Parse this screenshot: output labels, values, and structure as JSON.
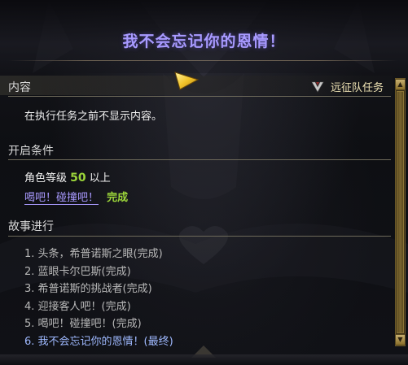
{
  "title": "我不会忘记你的恩情！",
  "content": {
    "header": "内容",
    "quest_type_label": "远征队任务",
    "text": "在执行任务之前不显示内容。"
  },
  "conditions": {
    "header": "开启条件",
    "level_label": "角色等级",
    "level_value": "50",
    "level_suffix": "以上",
    "prereq_quest": "喝吧！碰撞吧！",
    "prereq_status": "完成"
  },
  "story": {
    "header": "故事进行",
    "items": [
      "1. 头条，希普诺斯之眼(完成)",
      "2. 蓝眼卡尔巴斯(完成)",
      "3. 希普诺斯的挑战者(完成)",
      "4. 迎接客人吧！(完成)",
      "5. 喝吧！碰撞吧！(完成)",
      "6. 我不会忘记你的恩情！(最终)"
    ]
  },
  "colors": {
    "title": "#a89aff",
    "level_value": "#9cd63a",
    "prereq_link": "#a99aff",
    "current_step": "#9fb9ff"
  },
  "icons": {
    "quest_marker": "yellow-triangle-icon",
    "expedition": "expedition-emblem-icon"
  }
}
